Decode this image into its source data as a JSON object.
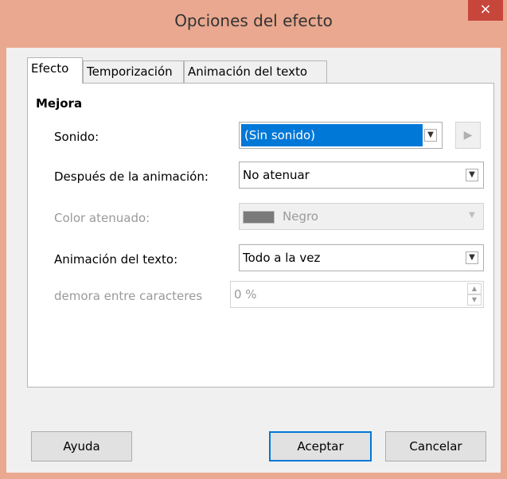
{
  "window": {
    "title": "Opciones del efecto",
    "close_glyph": "×"
  },
  "tabs": [
    {
      "label": "Efecto",
      "active": true
    },
    {
      "label": "Temporización",
      "active": false
    },
    {
      "label": "Animación del texto",
      "active": false
    }
  ],
  "group": {
    "title": "Mejora"
  },
  "fields": {
    "sound": {
      "label": "Sonido:",
      "value": "(Sin sonido)"
    },
    "after_animation": {
      "label": "Después de la animación:",
      "value": "No atenuar"
    },
    "dim_color": {
      "label": "Color atenuado:",
      "value": "Negro",
      "swatch_color": "#7a7a7a"
    },
    "text_animation": {
      "label": "Animación del texto:",
      "value": "Todo a la vez"
    },
    "char_delay": {
      "label": "demora entre caracteres",
      "value": "0 %"
    }
  },
  "buttons": {
    "help": "Ayuda",
    "ok": "Aceptar",
    "cancel": "Cancelar"
  },
  "icons": {
    "play": "play-icon",
    "dropdown": "chevron-down-icon",
    "spin_up": "spin-up-icon",
    "spin_down": "spin-down-icon",
    "close": "close-icon"
  },
  "colors": {
    "titlebar": "#e9a88f",
    "close": "#c7463c",
    "selection": "#0078d7"
  }
}
